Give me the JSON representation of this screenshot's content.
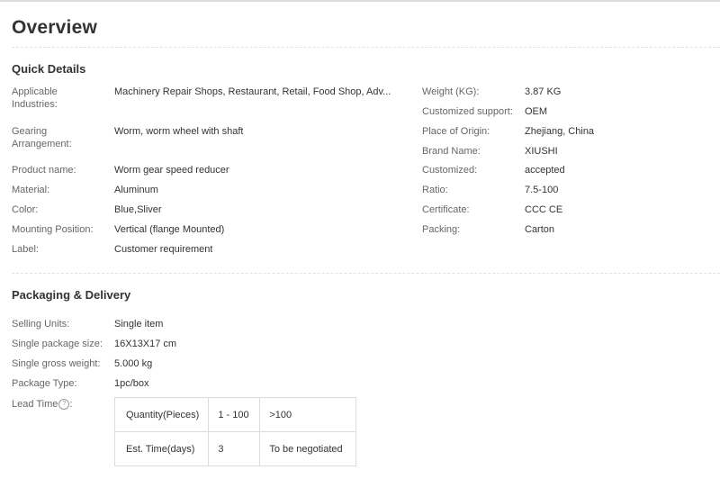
{
  "page": {
    "title": "Overview"
  },
  "quick_details": {
    "title": "Quick Details",
    "left": [
      {
        "label": "Applicable\nIndustries:",
        "value": "Machinery Repair Shops, Restaurant, Retail, Food Shop, Adv..."
      },
      {
        "label": "Gearing\nArrangement:",
        "value": "Worm, worm wheel with shaft"
      },
      {
        "label": "Product name:",
        "value": "Worm gear speed reducer"
      },
      {
        "label": "Material:",
        "value": "Aluminum"
      },
      {
        "label": "Color:",
        "value": "Blue,Sliver"
      },
      {
        "label": "Mounting Position:",
        "value": "Vertical (flange Mounted)"
      },
      {
        "label": "Label:",
        "value": "Customer requirement"
      }
    ],
    "right": [
      {
        "label": "Weight (KG):",
        "value": "3.87 KG"
      },
      {
        "label": "Customized support:",
        "value": "OEM"
      },
      {
        "label": "Place of Origin:",
        "value": "Zhejiang, China"
      },
      {
        "label": "Brand Name:",
        "value": "XIUSHI"
      },
      {
        "label": "Customized:",
        "value": "accepted"
      },
      {
        "label": "Ratio:",
        "value": "7.5-100"
      },
      {
        "label": "Certificate:",
        "value": "CCC CE"
      },
      {
        "label": "Packing:",
        "value": "Carton"
      }
    ]
  },
  "packaging": {
    "title": "Packaging & Delivery",
    "rows": [
      {
        "label": "Selling Units:",
        "value": "Single item"
      },
      {
        "label": "Single package size:",
        "value": "16X13X17 cm"
      },
      {
        "label": "Single gross weight:",
        "value": "5.000 kg"
      },
      {
        "label": "Package Type:",
        "value": "1pc/box"
      }
    ],
    "lead_time": {
      "label": "Lead Time",
      "help_icon": "question-circle-icon",
      "help_glyph": "?",
      "table": [
        [
          "Quantity(Pieces)",
          "1 - 100",
          ">100"
        ],
        [
          "Est. Time(days)",
          "3",
          "To be negotiated"
        ]
      ]
    }
  }
}
